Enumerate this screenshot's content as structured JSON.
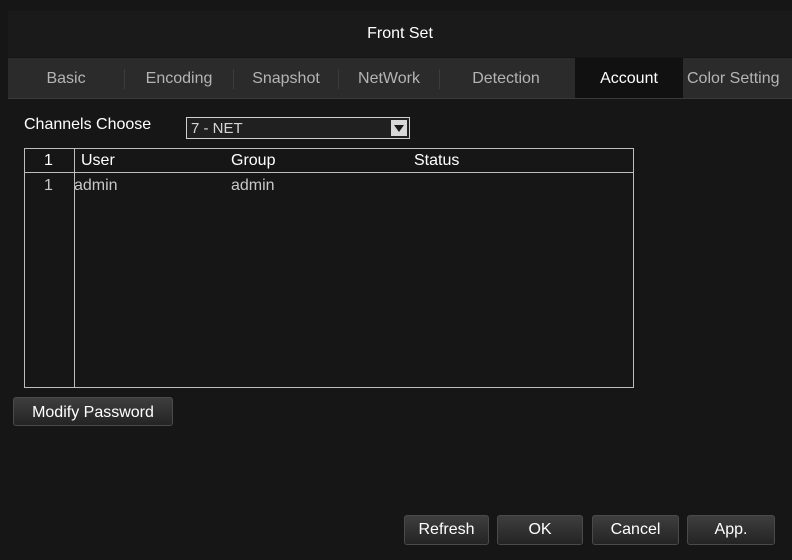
{
  "window": {
    "title": "Front Set"
  },
  "tabs": [
    {
      "label": "Basic",
      "active": false
    },
    {
      "label": "Encoding",
      "active": false
    },
    {
      "label": "Snapshot",
      "active": false
    },
    {
      "label": "NetWork",
      "active": false
    },
    {
      "label": "Detection",
      "active": false
    },
    {
      "label": "Account",
      "active": true
    },
    {
      "label": "Color Setting",
      "active": false
    }
  ],
  "channel": {
    "label": "Channels Choose",
    "value": "7 - NET"
  },
  "table": {
    "headers": {
      "index": "1",
      "user": "User",
      "group": "Group",
      "status": "Status"
    },
    "rows": [
      {
        "index": "1",
        "user": "admin",
        "group": "admin",
        "status": ""
      }
    ]
  },
  "actions": {
    "modify_password": "Modify Password"
  },
  "footer": {
    "refresh": "Refresh",
    "ok": "OK",
    "cancel": "Cancel",
    "apply": "App."
  },
  "colors": {
    "background": "#161616",
    "tabbar": "#2b2b2b",
    "active_tab": "#111111",
    "text": "#ffffff",
    "muted_text": "#b4b4b4"
  }
}
